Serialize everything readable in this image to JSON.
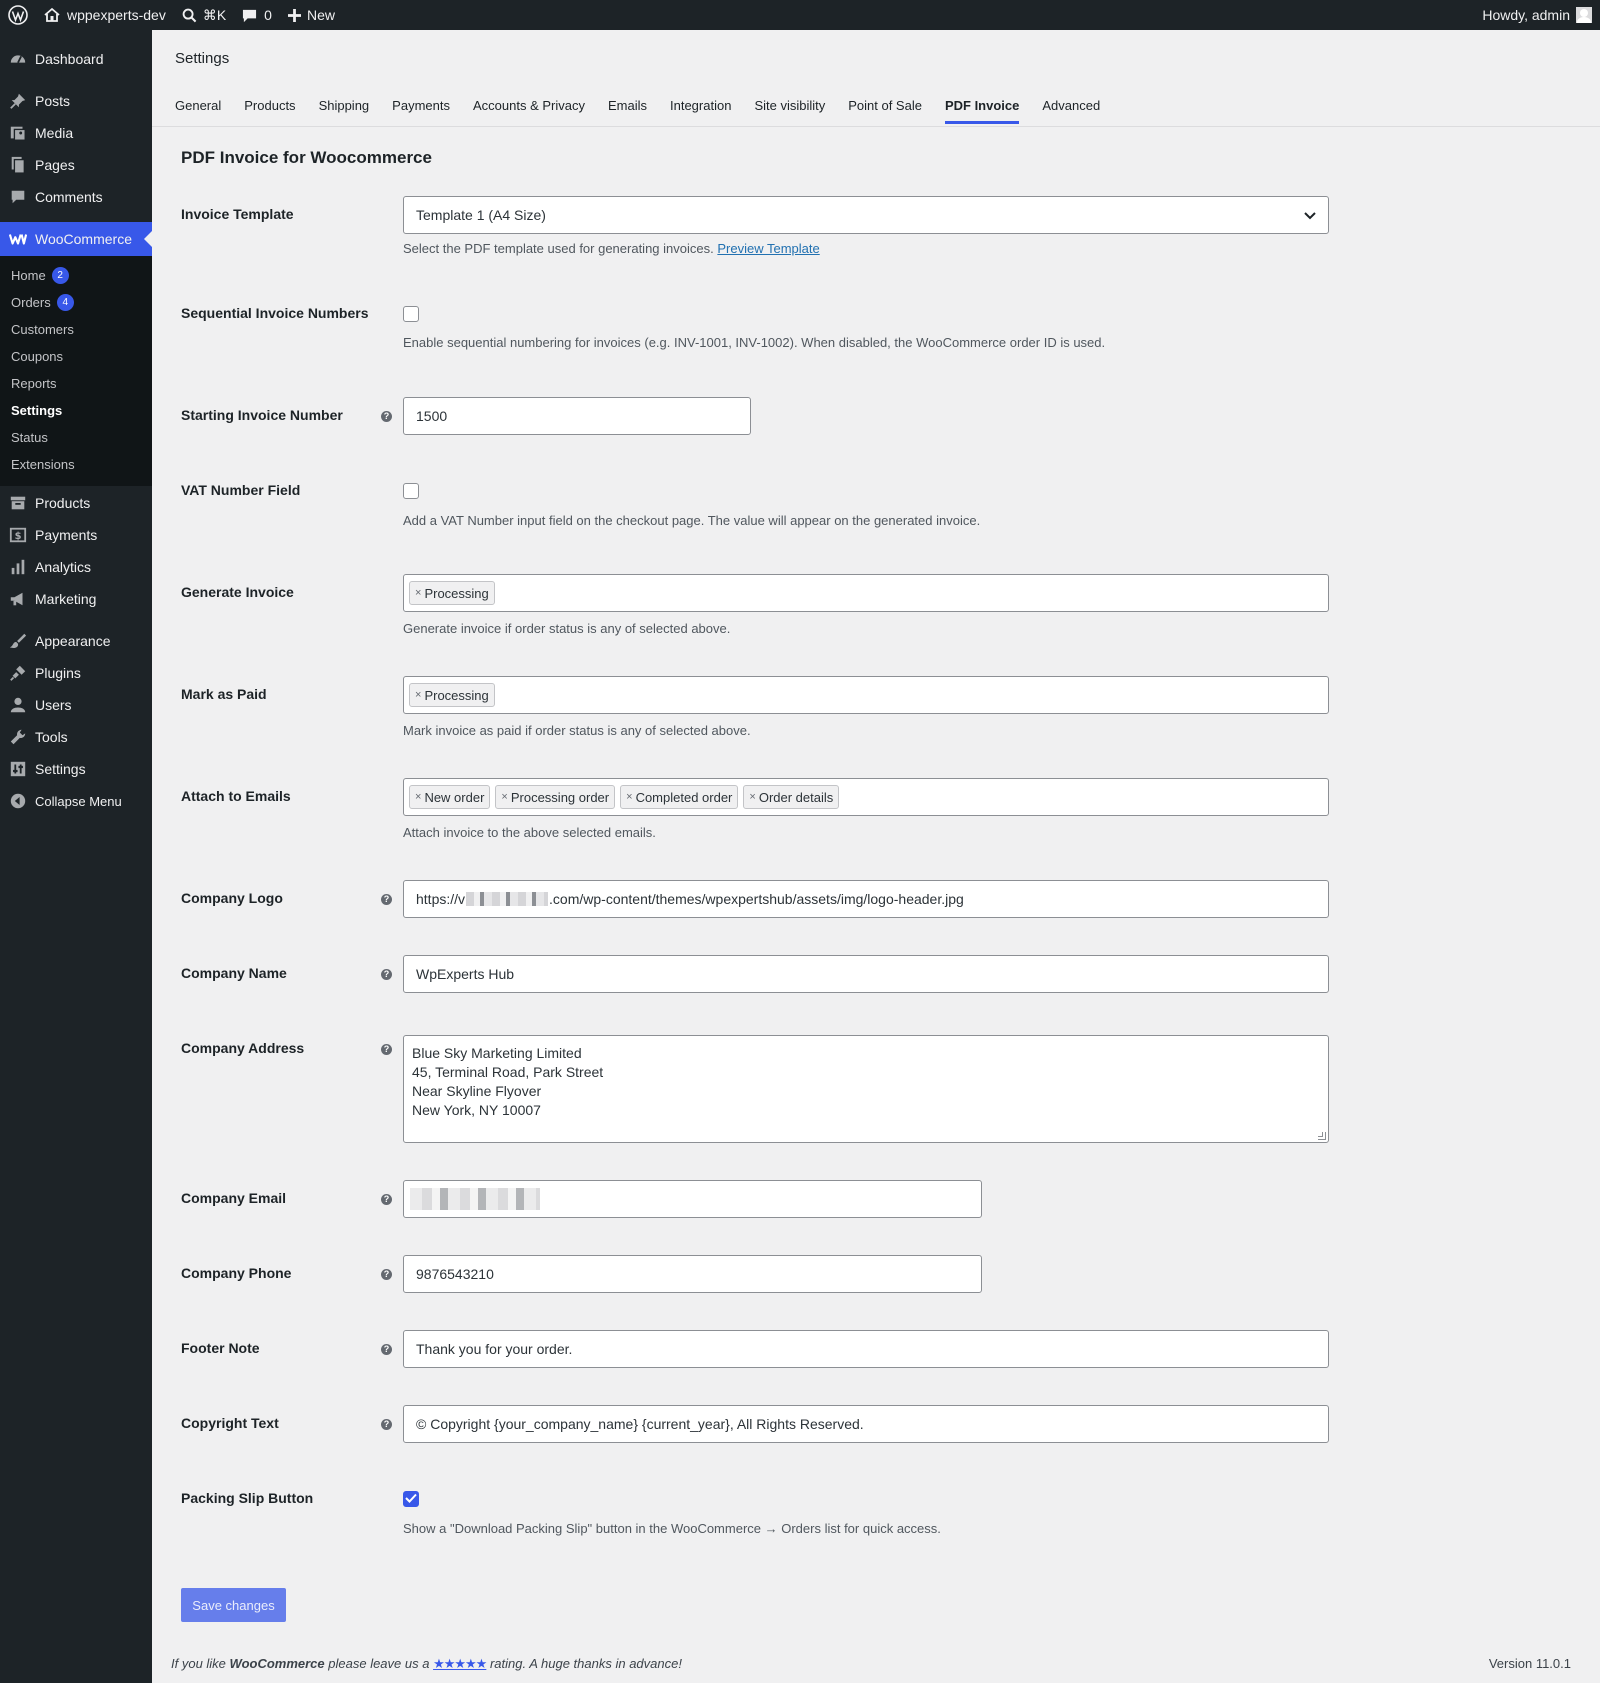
{
  "adminbar": {
    "site_name": "wppexperts-dev",
    "search_shortcut": "⌘K",
    "comments_count": "0",
    "new_label": "New",
    "howdy": "Howdy, admin"
  },
  "sidebar": {
    "top_items": [
      {
        "label": "Dashboard",
        "icon": "dashboard-icon"
      },
      {
        "label": "Posts",
        "icon": "pin-icon"
      },
      {
        "label": "Media",
        "icon": "media-icon"
      },
      {
        "label": "Pages",
        "icon": "pages-icon"
      },
      {
        "label": "Comments",
        "icon": "comment-icon"
      }
    ],
    "woocommerce": {
      "label": "WooCommerce",
      "icon": "woocommerce-icon"
    },
    "submenu": [
      {
        "label": "Home",
        "badge": "2"
      },
      {
        "label": "Orders",
        "badge": "4"
      },
      {
        "label": "Customers"
      },
      {
        "label": "Coupons"
      },
      {
        "label": "Reports"
      },
      {
        "label": "Settings"
      },
      {
        "label": "Status"
      },
      {
        "label": "Extensions"
      }
    ],
    "bottom_items": [
      {
        "label": "Products",
        "icon": "archive-icon"
      },
      {
        "label": "Payments",
        "icon": "money-icon"
      },
      {
        "label": "Analytics",
        "icon": "bar-chart-icon"
      },
      {
        "label": "Marketing",
        "icon": "megaphone-icon"
      },
      {
        "label": "Appearance",
        "icon": "brush-icon"
      },
      {
        "label": "Plugins",
        "icon": "plug-icon"
      },
      {
        "label": "Users",
        "icon": "user-icon"
      },
      {
        "label": "Tools",
        "icon": "wrench-icon"
      },
      {
        "label": "Settings",
        "icon": "sliders-icon"
      },
      {
        "label": "Collapse Menu",
        "icon": "collapse-icon"
      }
    ]
  },
  "page": {
    "heading": "Settings",
    "tabs": [
      "General",
      "Products",
      "Shipping",
      "Payments",
      "Accounts & Privacy",
      "Emails",
      "Integration",
      "Site visibility",
      "Point of Sale",
      "PDF Invoice",
      "Advanced"
    ],
    "active_tab": "PDF Invoice",
    "section_title": "PDF Invoice for Woocommerce"
  },
  "form": {
    "invoice_template": {
      "label": "Invoice Template",
      "value": "Template 1 (A4 Size)",
      "desc": "Select the PDF template used for generating invoices.",
      "link": "Preview Template"
    },
    "sequential": {
      "label": "Sequential Invoice Numbers",
      "checked": false,
      "desc": "Enable sequential numbering for invoices (e.g. INV-1001, INV-1002). When disabled, the WooCommerce order ID is used."
    },
    "starting_number": {
      "label": "Starting Invoice Number",
      "value": "1500"
    },
    "vat": {
      "label": "VAT Number Field",
      "checked": false,
      "desc": "Add a VAT Number input field on the checkout page. The value will appear on the generated invoice."
    },
    "generate_invoice": {
      "label": "Generate Invoice",
      "tags": [
        "Processing"
      ],
      "desc": "Generate invoice if order status is any of selected above."
    },
    "mark_paid": {
      "label": "Mark as Paid",
      "tags": [
        "Processing"
      ],
      "desc": "Mark invoice as paid if order status is any of selected above."
    },
    "attach_emails": {
      "label": "Attach to Emails",
      "tags": [
        "New order",
        "Processing order",
        "Completed order",
        "Order details"
      ],
      "desc": "Attach invoice to the above selected emails."
    },
    "company_logo": {
      "label": "Company Logo",
      "value_prefix": "https://v",
      "value_suffix": ".com/wp-content/themes/wpexpertshub/assets/img/logo-header.jpg"
    },
    "company_name": {
      "label": "Company Name",
      "value": "WpExperts Hub"
    },
    "company_address": {
      "label": "Company Address",
      "value": "Blue Sky Marketing Limited\n45, Terminal Road, Park Street\nNear Skyline Flyover\nNew York, NY 10007"
    },
    "company_email": {
      "label": "Company Email"
    },
    "company_phone": {
      "label": "Company Phone",
      "value": "9876543210"
    },
    "footer_note": {
      "label": "Footer Note",
      "value": "Thank you for your order."
    },
    "copyright": {
      "label": "Copyright Text",
      "value": "© Copyright {your_company_name} {current_year}, All Rights Reserved."
    },
    "packing_slip": {
      "label": "Packing Slip Button",
      "checked": true,
      "desc": "Show a \"Download Packing Slip\" button in the WooCommerce → Orders list for quick access."
    },
    "save_label": "Save changes"
  },
  "footer": {
    "text_before": "If you like ",
    "brand": "WooCommerce",
    "text_mid": " please leave us a ",
    "stars": "★★★★★",
    "text_after": " rating. A huge thanks in advance!",
    "version": "Version 11.0.1"
  },
  "colors": {
    "accent": "#3858e9",
    "adminbar": "#1d2327",
    "background": "#f0f0f1"
  }
}
